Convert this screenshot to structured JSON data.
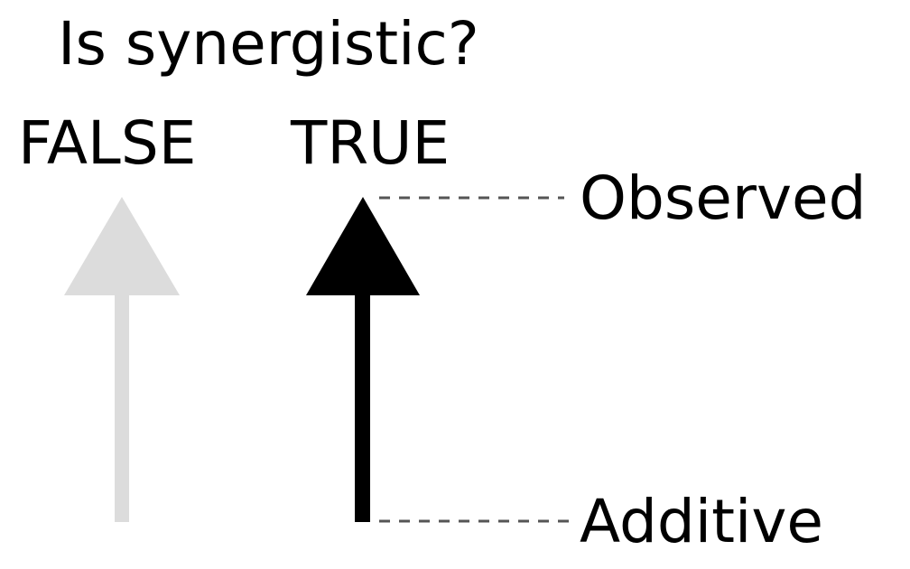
{
  "legend": {
    "title": "Is synergistic?",
    "levels": [
      {
        "label": "FALSE",
        "color": "#dcdcdc"
      },
      {
        "label": "TRUE",
        "color": "#000000"
      }
    ],
    "ends": {
      "top": "Observed",
      "bottom": "Additive"
    },
    "guide_color": "#555555"
  }
}
